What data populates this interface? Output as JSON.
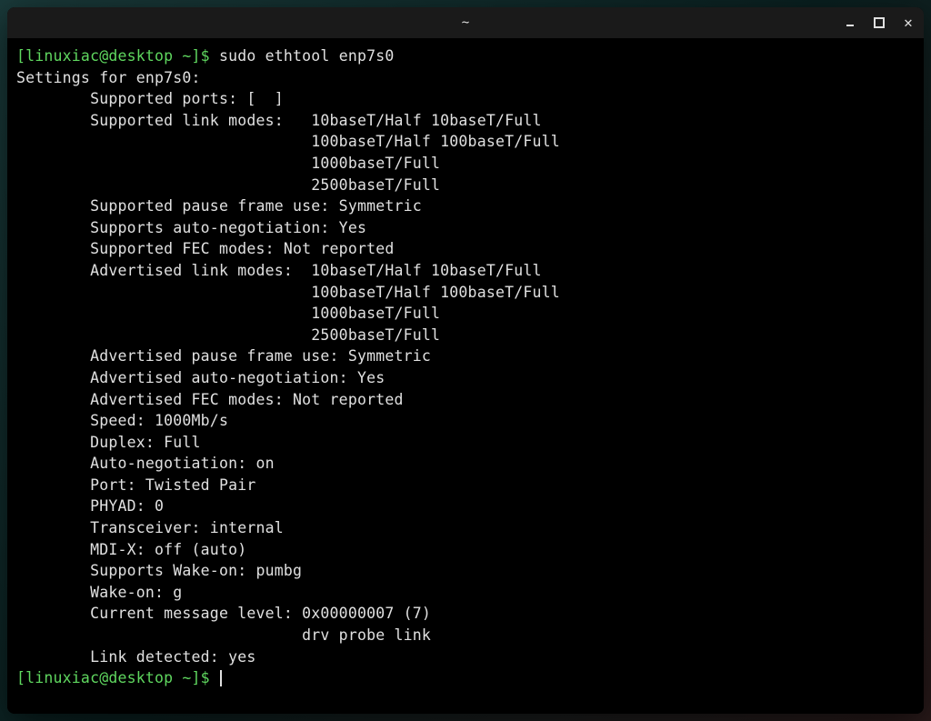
{
  "window": {
    "title": "~"
  },
  "colors": {
    "prompt_green": "#5fd75f",
    "foreground": "#e0e0e0",
    "background": "#000000"
  },
  "prompt1": {
    "full": "[linuxiac@desktop ~]$ ",
    "command": "sudo ethtool enp7s0"
  },
  "output": {
    "header": "Settings for enp7s0:",
    "lines": [
      "        Supported ports: [  ]",
      "        Supported link modes:   10baseT/Half 10baseT/Full",
      "                                100baseT/Half 100baseT/Full",
      "                                1000baseT/Full",
      "                                2500baseT/Full",
      "        Supported pause frame use: Symmetric",
      "        Supports auto-negotiation: Yes",
      "        Supported FEC modes: Not reported",
      "        Advertised link modes:  10baseT/Half 10baseT/Full",
      "                                100baseT/Half 100baseT/Full",
      "                                1000baseT/Full",
      "                                2500baseT/Full",
      "        Advertised pause frame use: Symmetric",
      "        Advertised auto-negotiation: Yes",
      "        Advertised FEC modes: Not reported",
      "        Speed: 1000Mb/s",
      "        Duplex: Full",
      "        Auto-negotiation: on",
      "        Port: Twisted Pair",
      "        PHYAD: 0",
      "        Transceiver: internal",
      "        MDI-X: off (auto)",
      "        Supports Wake-on: pumbg",
      "        Wake-on: g",
      "        Current message level: 0x00000007 (7)",
      "                               drv probe link",
      "        Link detected: yes"
    ]
  },
  "prompt2": {
    "full": "[linuxiac@desktop ~]$ "
  }
}
